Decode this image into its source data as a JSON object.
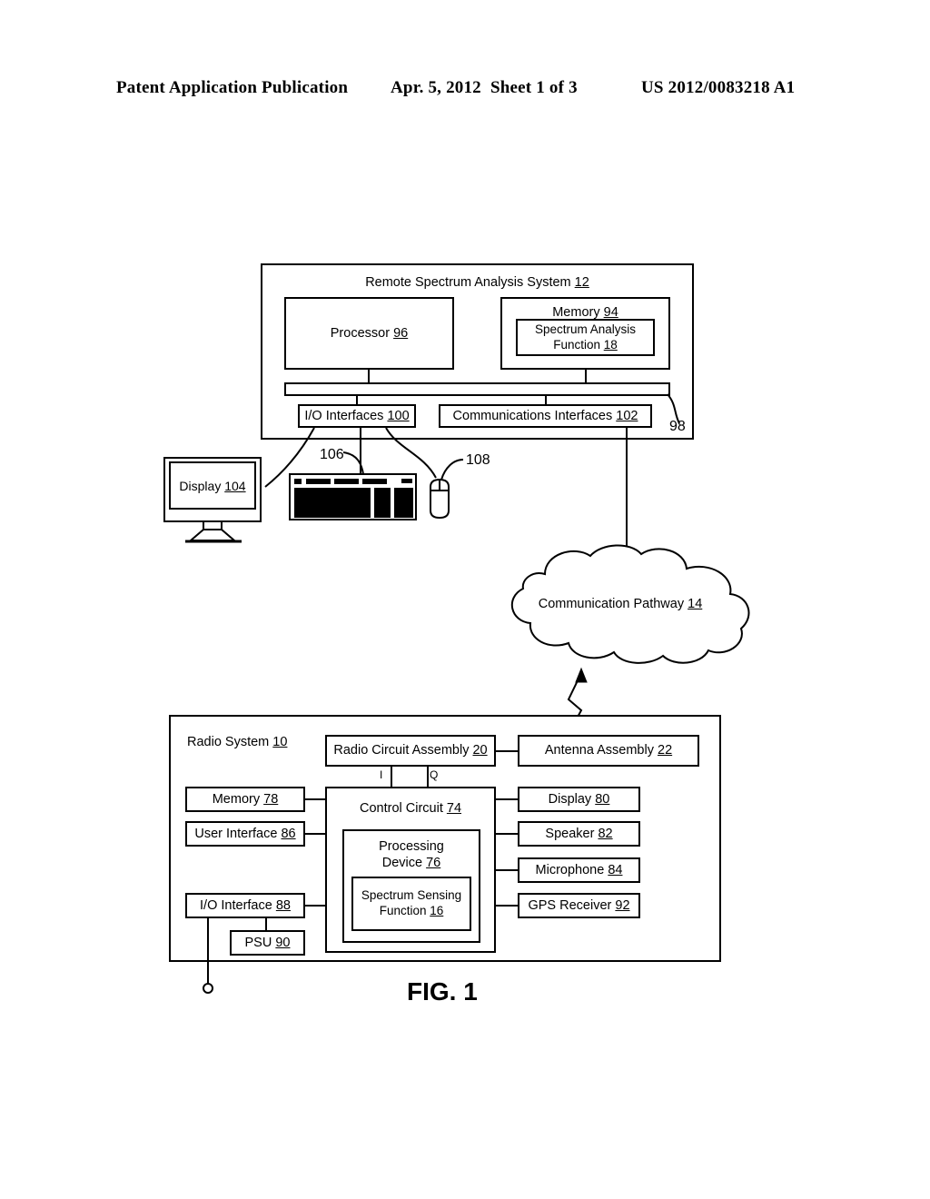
{
  "header": {
    "title": "Patent Application Publication",
    "date": "Apr. 5, 2012",
    "sheet": "Sheet 1 of 3",
    "pub_number": "US 2012/0083218 A1"
  },
  "figure": {
    "caption": "FIG. 1"
  },
  "remote_system": {
    "title": "Remote Spectrum Analysis System ",
    "title_ref": "12",
    "processor": {
      "label": "Processor ",
      "ref": "96"
    },
    "memory": {
      "label": "Memory ",
      "ref": "94"
    },
    "spectrum_analysis_function": {
      "line1": "Spectrum Analysis",
      "line2": "Function ",
      "ref": "18"
    },
    "bus_ref": "98",
    "io_interfaces": {
      "label": "I/O Interfaces ",
      "ref": "100"
    },
    "comm_interfaces": {
      "label": "Communications Interfaces ",
      "ref": "102"
    }
  },
  "peripherals": {
    "display": {
      "label": "Display ",
      "ref": "104"
    },
    "keyboard_ref": "106",
    "mouse_ref": "108"
  },
  "cloud": {
    "label": "Communication Pathway ",
    "ref": "14"
  },
  "radio_system": {
    "title": "Radio System ",
    "title_ref": "10",
    "radio_circuit_assembly": {
      "label": "Radio Circuit Assembly ",
      "ref": "20"
    },
    "antenna_assembly": {
      "label": "Antenna Assembly ",
      "ref": "22"
    },
    "signal_i": "I",
    "signal_q": "Q",
    "memory": {
      "label": "Memory ",
      "ref": "78"
    },
    "user_interface": {
      "label": "User Interface ",
      "ref": "86"
    },
    "io_interface": {
      "label": "I/O Interface ",
      "ref": "88"
    },
    "psu": {
      "label": "PSU ",
      "ref": "90"
    },
    "control_circuit": {
      "label": "Control Circuit ",
      "ref": "74"
    },
    "processing_device": {
      "line1": "Processing",
      "line2": "Device ",
      "ref": "76"
    },
    "spectrum_sensing_function": {
      "line1": "Spectrum Sensing",
      "line2": "Function ",
      "ref": "16"
    },
    "display": {
      "label": "Display ",
      "ref": "80"
    },
    "speaker": {
      "label": "Speaker ",
      "ref": "82"
    },
    "microphone": {
      "label": "Microphone ",
      "ref": "84"
    },
    "gps_receiver": {
      "label": "GPS Receiver ",
      "ref": "92"
    }
  }
}
